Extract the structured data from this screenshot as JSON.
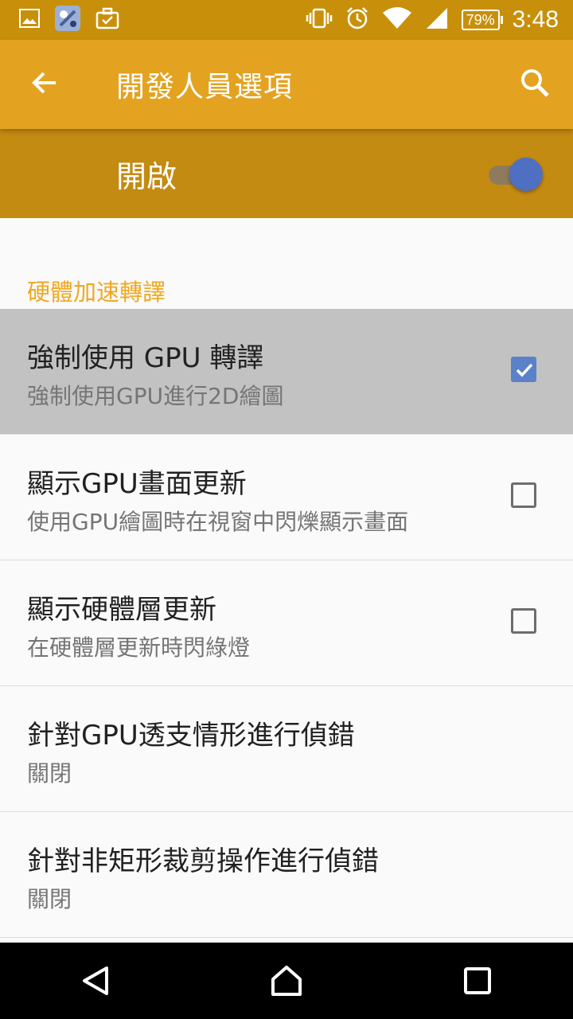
{
  "status_bar": {
    "time": "3:48",
    "battery": "79%",
    "left_icons": [
      "image-icon",
      "game-icon",
      "briefcase-check-icon"
    ],
    "right_icons": [
      "vibrate-icon",
      "alarm-icon",
      "wifi-icon",
      "signal-icon",
      "battery-icon"
    ]
  },
  "app_bar": {
    "title": "開發人員選項",
    "back_icon": "arrow-left-icon",
    "search_icon": "search-icon"
  },
  "master_switch": {
    "label": "開啟",
    "on": true
  },
  "section": {
    "header": "硬體加速轉譯"
  },
  "items": [
    {
      "title": "強制使用 GPU 轉譯",
      "summary": "強制使用GPU進行2D繪圖",
      "checkbox": true,
      "checked": true,
      "selected": true
    },
    {
      "title": "顯示GPU畫面更新",
      "summary": "使用GPU繪圖時在視窗中閃爍顯示畫面",
      "checkbox": true,
      "checked": false
    },
    {
      "title": "顯示硬體層更新",
      "summary": "在硬體層更新時閃綠燈",
      "checkbox": true,
      "checked": false
    },
    {
      "title": "針對GPU透支情形進行偵錯",
      "summary": "關閉"
    },
    {
      "title": "針對非矩形裁剪操作進行偵錯",
      "summary": "關閉"
    }
  ],
  "nav_bar": [
    "back-triangle-icon",
    "home-icon",
    "recents-icon"
  ],
  "colors": {
    "status_bar": "#c8900a",
    "app_bar": "#e3a320",
    "master_bar": "#c48b12",
    "accent_text": "#f0a820",
    "checkbox_checked": "#5b82c8",
    "switch_thumb": "#4f6fc2"
  }
}
